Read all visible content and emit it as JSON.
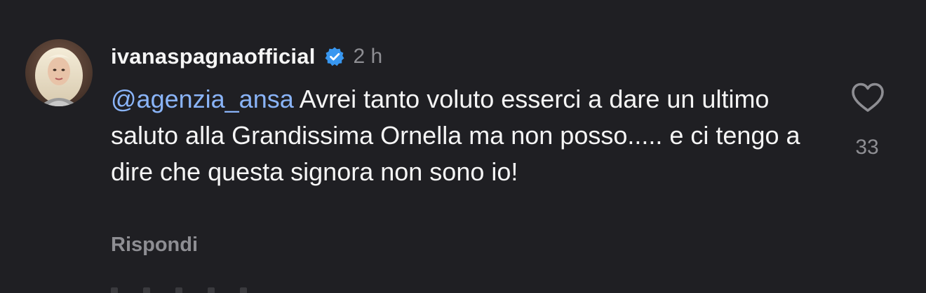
{
  "comment": {
    "username": "ivanaspagnaofficial",
    "verified": true,
    "verified_icon": "verified-badge-icon",
    "timestamp": "2 h",
    "mention": "@agenzia_ansa",
    "text": " Avrei tanto voluto esserci a dare un ultimo saluto alla Grandissima Ornella ma non posso..... e ci tengo a dire che questa signora non sono io!",
    "reply_label": "Rispondi",
    "like_icon": "heart-outline-icon",
    "like_count": "33"
  },
  "colors": {
    "background": "#1f1f23",
    "text_primary": "#f5f5f5",
    "text_secondary": "#8e8e93",
    "mention": "#8ab4f8",
    "verified": "#3897f0"
  }
}
